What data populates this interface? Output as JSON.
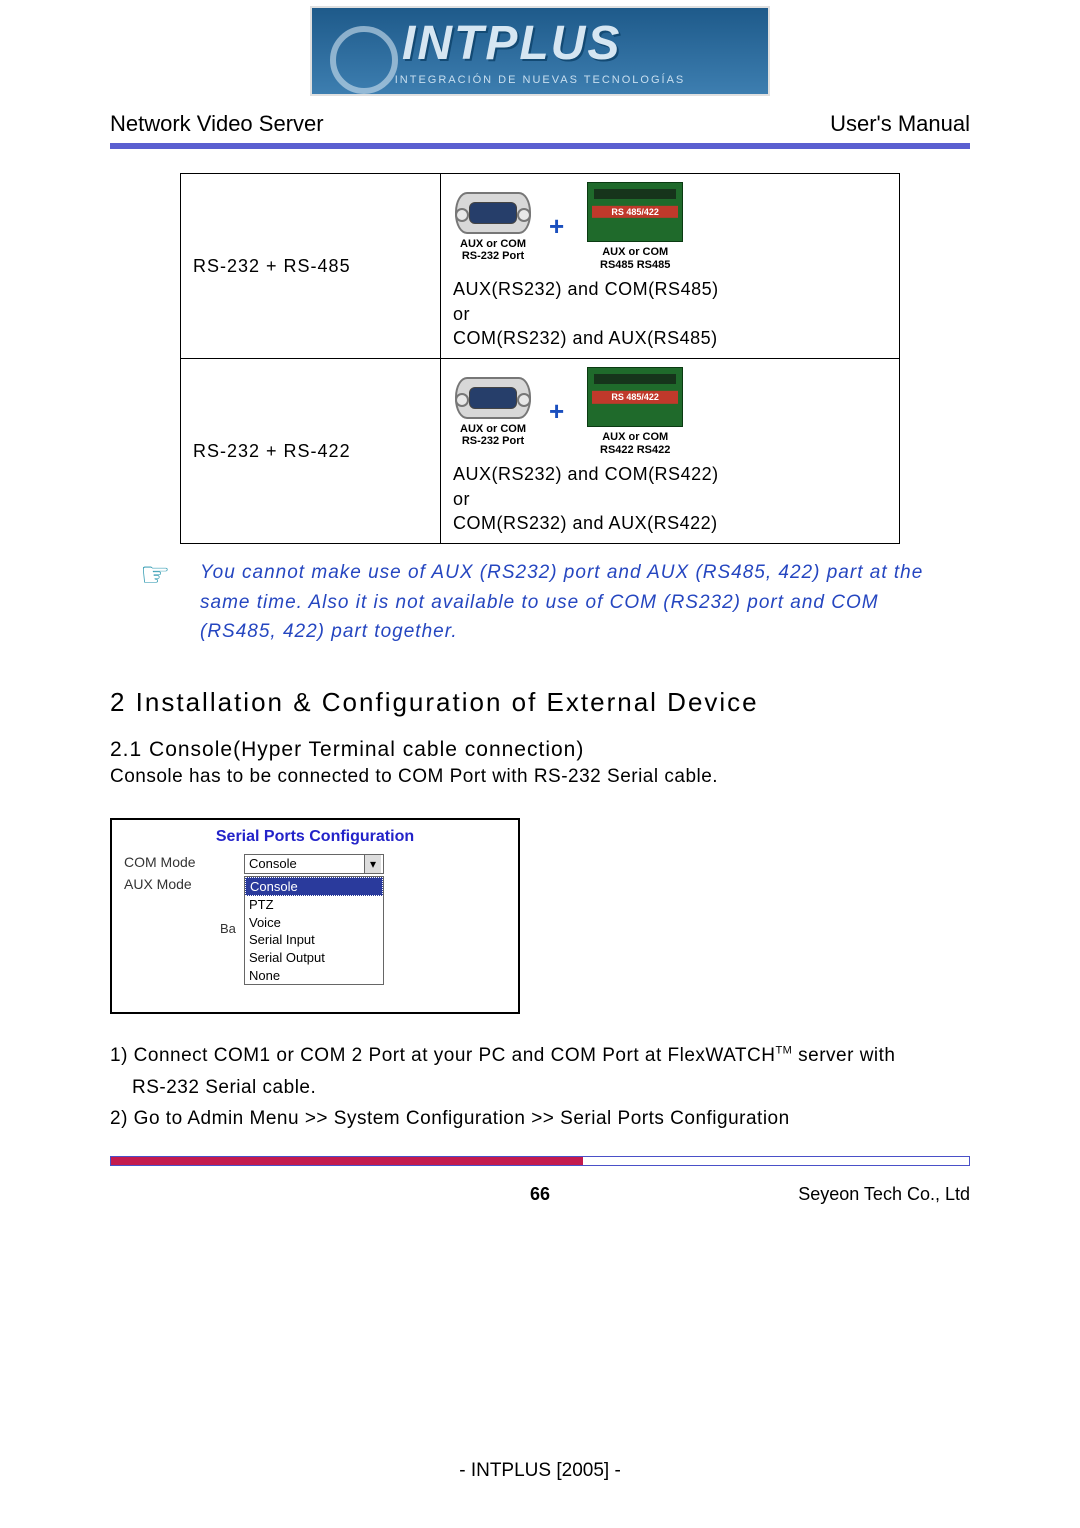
{
  "logo": {
    "brand": "INTPLUS",
    "tagline": "INTEGRACIÓN DE NUEVAS TECNOLOGÍAS"
  },
  "header": {
    "left": "Network Video Server",
    "right": "User's Manual"
  },
  "table": {
    "row1": {
      "left": "RS-232 + RS-485",
      "port_label": "AUX or COM\nRS-232 Port",
      "term_red": "RS 485/422",
      "term_label": "AUX or COM\nRS485   RS485",
      "text": "AUX(RS232) and COM(RS485)\nor\nCOM(RS232) and AUX(RS485)"
    },
    "row2": {
      "left": "RS-232 + RS-422",
      "port_label": "AUX or COM\nRS-232 Port",
      "term_red": "RS 485/422",
      "term_label": "AUX or COM\nRS422   RS422",
      "text": "AUX(RS232) and COM(RS422)\nor\nCOM(RS232) and AUX(RS422)"
    }
  },
  "note": "You cannot make use of AUX (RS232) port and AUX (RS485, 422) part at the same time. Also it is not available to use of COM (RS232) port and COM (RS485, 422) part together.",
  "section": {
    "h2": "2 Installation & Configuration of External Device",
    "h3": "2.1 Console(Hyper Terminal cable connection)",
    "intro": "Console has to be connected to COM Port with RS-232 Serial cable."
  },
  "screenshot": {
    "title": "Serial Ports Configuration",
    "rows": {
      "com": {
        "label": "COM Mode",
        "value": "Console"
      },
      "aux": {
        "label": "AUX Mode"
      }
    },
    "dropdown": [
      "Console",
      "PTZ",
      "Voice",
      "Serial Input",
      "Serial Output",
      "None"
    ],
    "back_fragment": "Ba"
  },
  "steps": {
    "s1a": "1)  Connect COM1 or COM 2 Port at your PC and COM Port at FlexWATCH",
    "s1tm": "TM",
    "s1b": " server with",
    "s1c": "RS-232 Serial cable.",
    "s2": "2)  Go to Admin Menu >> System Configuration >> Serial Ports Configuration"
  },
  "footer": {
    "page": "66",
    "company": "Seyeon Tech Co., Ltd",
    "stamp": "- INTPLUS [2005] -"
  }
}
